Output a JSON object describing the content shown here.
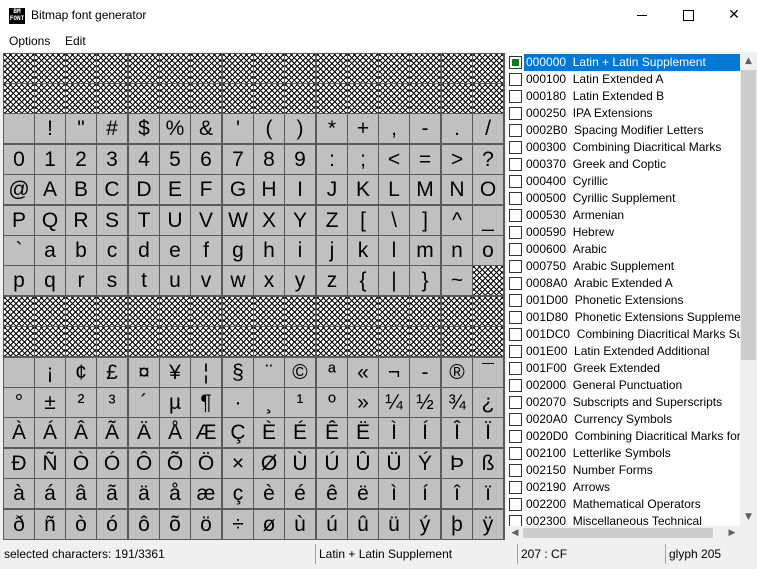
{
  "window": {
    "title": "Bitmap font generator",
    "icon_text": "BM FONT",
    "icon": "app-icon"
  },
  "menu": [
    {
      "label": "Options"
    },
    {
      "label": "Edit"
    }
  ],
  "grid": {
    "rows": [
      [
        "",
        "",
        "",
        "",
        "",
        "",
        "",
        "",
        "",
        "",
        "",
        "",
        "",
        "",
        "",
        ""
      ],
      [
        "",
        "",
        "",
        "",
        "",
        "",
        "",
        "",
        "",
        "",
        "",
        "",
        "",
        "",
        "",
        ""
      ],
      [
        " ",
        "!",
        "\"",
        "#",
        "$",
        "%",
        "&",
        "'",
        "(",
        ")",
        "*",
        "+",
        ",",
        "-",
        ".",
        "/"
      ],
      [
        "0",
        "1",
        "2",
        "3",
        "4",
        "5",
        "6",
        "7",
        "8",
        "9",
        ":",
        ";",
        "<",
        "=",
        ">",
        "?"
      ],
      [
        "@",
        "A",
        "B",
        "C",
        "D",
        "E",
        "F",
        "G",
        "H",
        "I",
        "J",
        "K",
        "L",
        "M",
        "N",
        "O"
      ],
      [
        "P",
        "Q",
        "R",
        "S",
        "T",
        "U",
        "V",
        "W",
        "X",
        "Y",
        "Z",
        "[",
        "\\",
        "]",
        "^",
        "_"
      ],
      [
        "`",
        "a",
        "b",
        "c",
        "d",
        "e",
        "f",
        "g",
        "h",
        "i",
        "j",
        "k",
        "l",
        "m",
        "n",
        "o"
      ],
      [
        "p",
        "q",
        "r",
        "s",
        "t",
        "u",
        "v",
        "w",
        "x",
        "y",
        "z",
        "{",
        "|",
        "}",
        "~",
        ""
      ],
      [
        "",
        "",
        "",
        "",
        "",
        "",
        "",
        "",
        "",
        "",
        "",
        "",
        "",
        "",
        "",
        ""
      ],
      [
        "",
        "",
        "",
        "",
        "",
        "",
        "",
        "",
        "",
        "",
        "",
        "",
        "",
        "",
        "",
        ""
      ],
      [
        " ",
        "¡",
        "¢",
        "£",
        "¤",
        "¥",
        "¦",
        "§",
        "¨",
        "©",
        "ª",
        "«",
        "¬",
        "-",
        "®",
        "¯"
      ],
      [
        "°",
        "±",
        "²",
        "³",
        "´",
        "µ",
        "¶",
        "·",
        "¸",
        "¹",
        "º",
        "»",
        "¼",
        "½",
        "¾",
        "¿"
      ],
      [
        "À",
        "Á",
        "Â",
        "Ã",
        "Ä",
        "Å",
        "Æ",
        "Ç",
        "È",
        "É",
        "Ê",
        "Ë",
        "Ì",
        "Í",
        "Î",
        "Ï"
      ],
      [
        "Ð",
        "Ñ",
        "Ò",
        "Ó",
        "Ô",
        "Õ",
        "Ö",
        "×",
        "Ø",
        "Ù",
        "Ú",
        "Û",
        "Ü",
        "Ý",
        "Þ",
        "ß"
      ],
      [
        "à",
        "á",
        "â",
        "ã",
        "ä",
        "å",
        "æ",
        "ç",
        "è",
        "é",
        "ê",
        "ë",
        "ì",
        "í",
        "î",
        "ï"
      ],
      [
        "ð",
        "ñ",
        "ò",
        "ó",
        "ô",
        "õ",
        "ö",
        "÷",
        "ø",
        "ù",
        "ú",
        "û",
        "ü",
        "ý",
        "þ",
        "ÿ"
      ]
    ],
    "empty_cells": [
      [
        0,
        0
      ],
      [
        0,
        1
      ],
      [
        0,
        2
      ],
      [
        0,
        3
      ],
      [
        0,
        4
      ],
      [
        0,
        5
      ],
      [
        0,
        6
      ],
      [
        0,
        7
      ],
      [
        0,
        8
      ],
      [
        0,
        9
      ],
      [
        0,
        10
      ],
      [
        0,
        11
      ],
      [
        0,
        12
      ],
      [
        0,
        13
      ],
      [
        0,
        14
      ],
      [
        0,
        15
      ],
      [
        1,
        0
      ],
      [
        1,
        1
      ],
      [
        1,
        2
      ],
      [
        1,
        3
      ],
      [
        1,
        4
      ],
      [
        1,
        5
      ],
      [
        1,
        6
      ],
      [
        1,
        7
      ],
      [
        1,
        8
      ],
      [
        1,
        9
      ],
      [
        1,
        10
      ],
      [
        1,
        11
      ],
      [
        1,
        12
      ],
      [
        1,
        13
      ],
      [
        1,
        14
      ],
      [
        1,
        15
      ],
      [
        7,
        15
      ],
      [
        8,
        0
      ],
      [
        8,
        1
      ],
      [
        8,
        2
      ],
      [
        8,
        3
      ],
      [
        8,
        4
      ],
      [
        8,
        5
      ],
      [
        8,
        6
      ],
      [
        8,
        7
      ],
      [
        8,
        8
      ],
      [
        8,
        9
      ],
      [
        8,
        10
      ],
      [
        8,
        11
      ],
      [
        8,
        12
      ],
      [
        8,
        13
      ],
      [
        8,
        14
      ],
      [
        8,
        15
      ],
      [
        9,
        0
      ],
      [
        9,
        1
      ],
      [
        9,
        2
      ],
      [
        9,
        3
      ],
      [
        9,
        4
      ],
      [
        9,
        5
      ],
      [
        9,
        6
      ],
      [
        9,
        7
      ],
      [
        9,
        8
      ],
      [
        9,
        9
      ],
      [
        9,
        10
      ],
      [
        9,
        11
      ],
      [
        9,
        12
      ],
      [
        9,
        13
      ],
      [
        9,
        14
      ],
      [
        9,
        15
      ]
    ]
  },
  "subsets": [
    {
      "code": "000000",
      "name": "Latin + Latin Supplement",
      "checked": true,
      "selected": true
    },
    {
      "code": "000100",
      "name": "Latin Extended A",
      "checked": false
    },
    {
      "code": "000180",
      "name": "Latin Extended B",
      "checked": false
    },
    {
      "code": "000250",
      "name": "IPA Extensions",
      "checked": false
    },
    {
      "code": "0002B0",
      "name": "Spacing Modifier Letters",
      "checked": false
    },
    {
      "code": "000300",
      "name": "Combining Diacritical Marks",
      "checked": false
    },
    {
      "code": "000370",
      "name": "Greek and Coptic",
      "checked": false
    },
    {
      "code": "000400",
      "name": "Cyrillic",
      "checked": false
    },
    {
      "code": "000500",
      "name": "Cyrillic Supplement",
      "checked": false
    },
    {
      "code": "000530",
      "name": "Armenian",
      "checked": false
    },
    {
      "code": "000590",
      "name": "Hebrew",
      "checked": false
    },
    {
      "code": "000600",
      "name": "Arabic",
      "checked": false
    },
    {
      "code": "000750",
      "name": "Arabic Supplement",
      "checked": false
    },
    {
      "code": "0008A0",
      "name": "Arabic Extended A",
      "checked": false
    },
    {
      "code": "001D00",
      "name": "Phonetic Extensions",
      "checked": false
    },
    {
      "code": "001D80",
      "name": "Phonetic Extensions Supplement",
      "checked": false
    },
    {
      "code": "001DC0",
      "name": "Combining Diacritical Marks Supplement",
      "checked": false
    },
    {
      "code": "001E00",
      "name": "Latin Extended Additional",
      "checked": false
    },
    {
      "code": "001F00",
      "name": "Greek Extended",
      "checked": false
    },
    {
      "code": "002000",
      "name": "General Punctuation",
      "checked": false
    },
    {
      "code": "002070",
      "name": "Subscripts and Superscripts",
      "checked": false
    },
    {
      "code": "0020A0",
      "name": "Currency Symbols",
      "checked": false
    },
    {
      "code": "0020D0",
      "name": "Combining Diacritical Marks for Symbols",
      "checked": false
    },
    {
      "code": "002100",
      "name": "Letterlike Symbols",
      "checked": false
    },
    {
      "code": "002150",
      "name": "Number Forms",
      "checked": false
    },
    {
      "code": "002190",
      "name": "Arrows",
      "checked": false
    },
    {
      "code": "002200",
      "name": "Mathematical Operators",
      "checked": false
    },
    {
      "code": "002300",
      "name": "Miscellaneous Technical",
      "checked": false
    }
  ],
  "status": {
    "selected": "selected characters: 191/3361",
    "range": "Latin + Latin Supplement",
    "code": "207 : CF",
    "glyph": "glyph 205"
  },
  "colors": {
    "selection": "#0078d7",
    "check": "#0a7a1a",
    "cell_bg": "#c0c0c0"
  }
}
